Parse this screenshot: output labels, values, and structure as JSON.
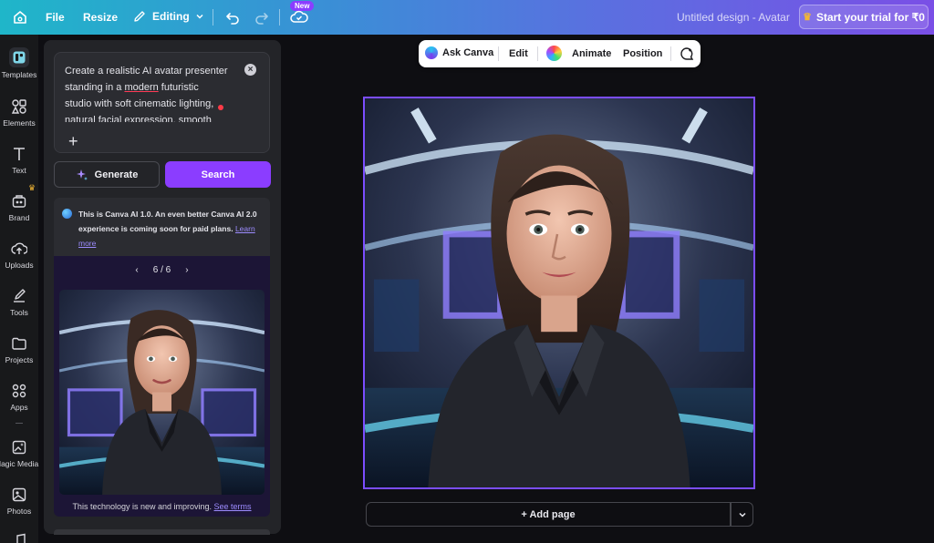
{
  "topbar": {
    "file_label": "File",
    "resize_label": "Resize",
    "editing_label": "Editing",
    "new_badge": "New",
    "doc_title": "Untitled design - Avatar",
    "trial_label": "Start your trial for ₹0",
    "gradient_start": "#1fb6c9",
    "gradient_end": "#7a4fe6"
  },
  "rail": {
    "items": [
      {
        "label": "Templates",
        "icon": "templates-icon"
      },
      {
        "label": "Elements",
        "icon": "elements-icon"
      },
      {
        "label": "Text",
        "icon": "text-icon"
      },
      {
        "label": "Brand",
        "icon": "brand-icon"
      },
      {
        "label": "Uploads",
        "icon": "uploads-icon"
      },
      {
        "label": "Tools",
        "icon": "tools-icon"
      },
      {
        "label": "Projects",
        "icon": "projects-icon"
      },
      {
        "label": "Apps",
        "icon": "apps-icon"
      },
      {
        "label": "Magic Media",
        "icon": "magic-media-icon"
      },
      {
        "label": "Photos",
        "icon": "photos-icon"
      }
    ]
  },
  "panel": {
    "prompt": {
      "line1": "Create a realistic AI avatar presenter",
      "line2_pre": "standing in a ",
      "line2_err": "modern",
      "line2_post": " futuristic",
      "line3": "studio with soft cinematic lighting,",
      "line4": "natural facial expression, smooth"
    },
    "generate_label": "Generate",
    "search_label": "Search",
    "info_text": "This is Canva AI 1.0. An even better Canva AI 2.0 experience is coming soon for paid plans.",
    "info_link": "Learn more",
    "pager": "6 / 6",
    "disclaimer": "This technology is new and improving.",
    "disclaimer_link": "See terms",
    "accent": "#8b3dff"
  },
  "floating_toolbar": {
    "ask_label": "Ask Canva",
    "edit_label": "Edit",
    "animate_label": "Animate",
    "position_label": "Position"
  },
  "canvas": {
    "add_page_label": "+ Add page",
    "selection_color": "#7b4dff"
  }
}
